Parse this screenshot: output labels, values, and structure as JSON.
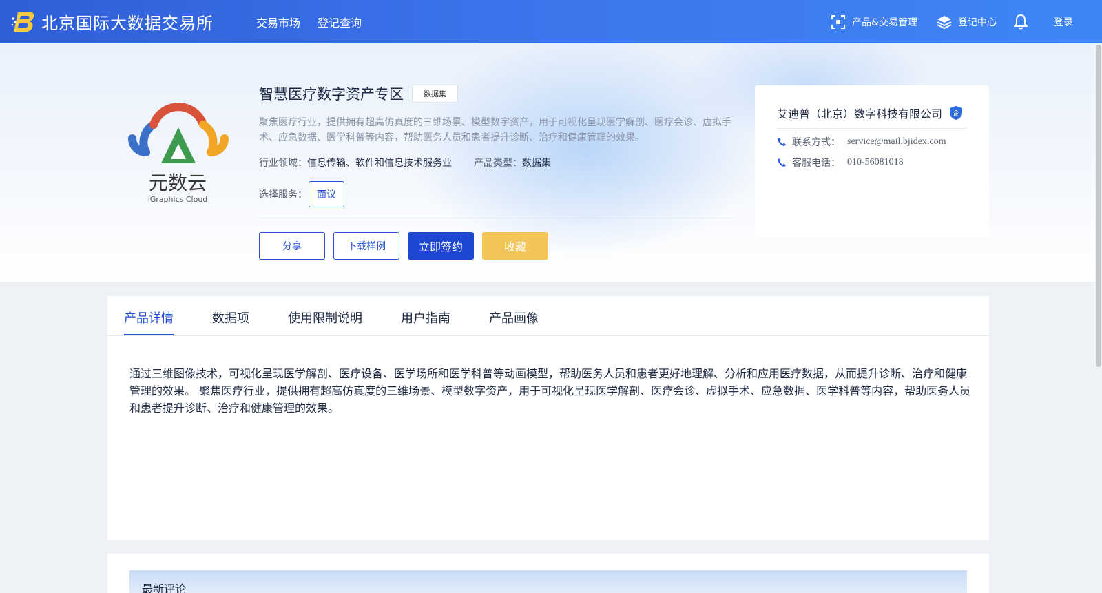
{
  "header": {
    "brand_name": "北京国际大数据交易所",
    "nav": [
      "交易市场",
      "登记查询"
    ],
    "products_label": "产品&交易管理",
    "register_center_label": "登记中心",
    "login_label": "登录",
    "colors": {
      "bar_start": "#2f5ed8",
      "bar_end": "#3f86f5"
    }
  },
  "product": {
    "logo_text": "元数云",
    "logo_subtext": "iGraphics Cloud",
    "title": "智慧医疗数字资产专区",
    "type_tag": "数据集",
    "description": "聚焦医疗行业，提供拥有超高仿真度的三维场景、模型数字资产，用于可视化呈现医学解剖、医疗会诊、虚拟手术、应急数据、医学科普等内容，帮助医务人员和患者提升诊断、治疗和健康管理的效果。",
    "industry_label": "行业领域：",
    "industry_value": "信息传输、软件和信息技术服务业",
    "product_type_label": "产品类型：",
    "product_type_value": "数据集",
    "service_label": "选择服务：",
    "service_option": "面议",
    "buttons": {
      "share": "分享",
      "download_sample": "下载样例",
      "sign_now": "立即签约",
      "favorite": "收藏"
    }
  },
  "company": {
    "name": "艾迪普（北京）数字科技有限公司",
    "badge": "企",
    "contact_label": "联系方式：",
    "contact_value": "service@mail.bjidex.com",
    "phone_label": "客服电话：",
    "phone_value": "010-56081018"
  },
  "tabs": [
    "产品详情",
    "数据项",
    "使用限制说明",
    "用户指南",
    "产品画像"
  ],
  "active_tab": "产品详情",
  "detail_text": "通过三维图像技术，可视化呈现医学解剖、医疗设备、医学场所和医学科普等动画模型，帮助医务人员和患者更好地理解、分析和应用医疗数据，从而提升诊断、治疗和健康管理的效果。 聚焦医疗行业，提供拥有超高仿真度的三维场景、模型数字资产，用于可视化呈现医学解剖、医疗会诊、虚拟手术、应急数据、医学科普等内容，帮助医务人员和患者提升诊断、治疗和健康管理的效果。",
  "comments": {
    "heading": "最新评论"
  },
  "icons": {
    "brand": "bjidex-logo-icon",
    "products": "scan-frame-icon",
    "register": "layers-icon",
    "notifications": "bell-icon",
    "verify": "enterprise-shield-icon",
    "phone": "phone-icon"
  }
}
